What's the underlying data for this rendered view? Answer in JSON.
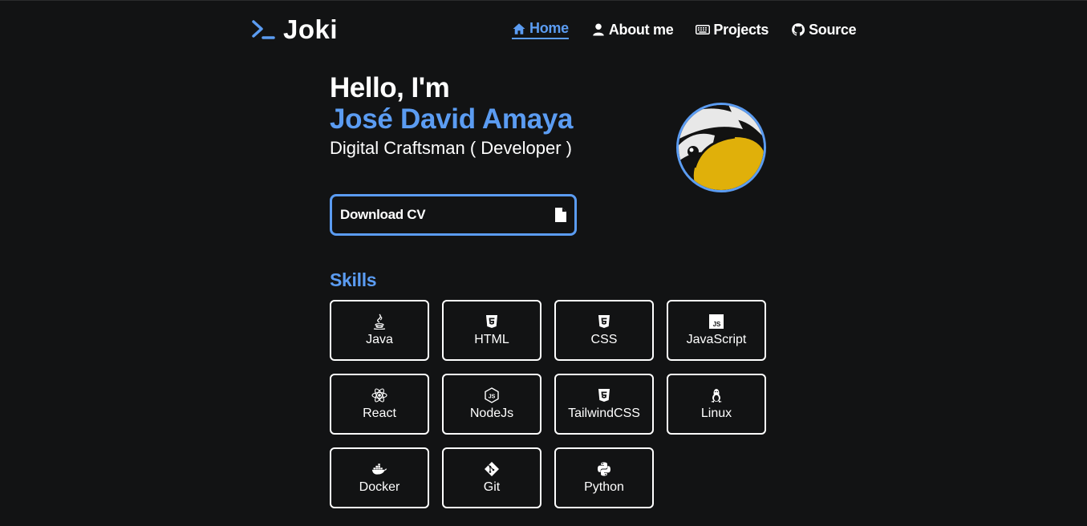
{
  "header": {
    "logo_text": "Joki",
    "nav": [
      {
        "label": "Home",
        "icon": "home-icon",
        "active": true
      },
      {
        "label": "About me",
        "icon": "user-icon"
      },
      {
        "label": "Projects",
        "icon": "keyboard-icon"
      },
      {
        "label": "Source",
        "icon": "github-icon"
      }
    ]
  },
  "hero": {
    "greeting": "Hello, I'm",
    "name": "José David Amaya",
    "role": "Digital Craftsman ( Developer )",
    "download_cv_label": "Download CV"
  },
  "skills": {
    "title": "Skills",
    "items": [
      {
        "label": "Java",
        "icon": "java-icon"
      },
      {
        "label": "HTML",
        "icon": "html5-icon"
      },
      {
        "label": "CSS",
        "icon": "css3-icon"
      },
      {
        "label": "JavaScript",
        "icon": "javascript-icon"
      },
      {
        "label": "React",
        "icon": "react-icon"
      },
      {
        "label": "NodeJs",
        "icon": "nodejs-icon"
      },
      {
        "label": "TailwindCSS",
        "icon": "css3-icon"
      },
      {
        "label": "Linux",
        "icon": "linux-icon"
      },
      {
        "label": "Docker",
        "icon": "docker-icon"
      },
      {
        "label": "Git",
        "icon": "git-icon"
      },
      {
        "label": "Python",
        "icon": "python-icon"
      }
    ]
  },
  "colors": {
    "background": "#121314",
    "accent": "#5b9cf2",
    "text": "#ffffff"
  }
}
